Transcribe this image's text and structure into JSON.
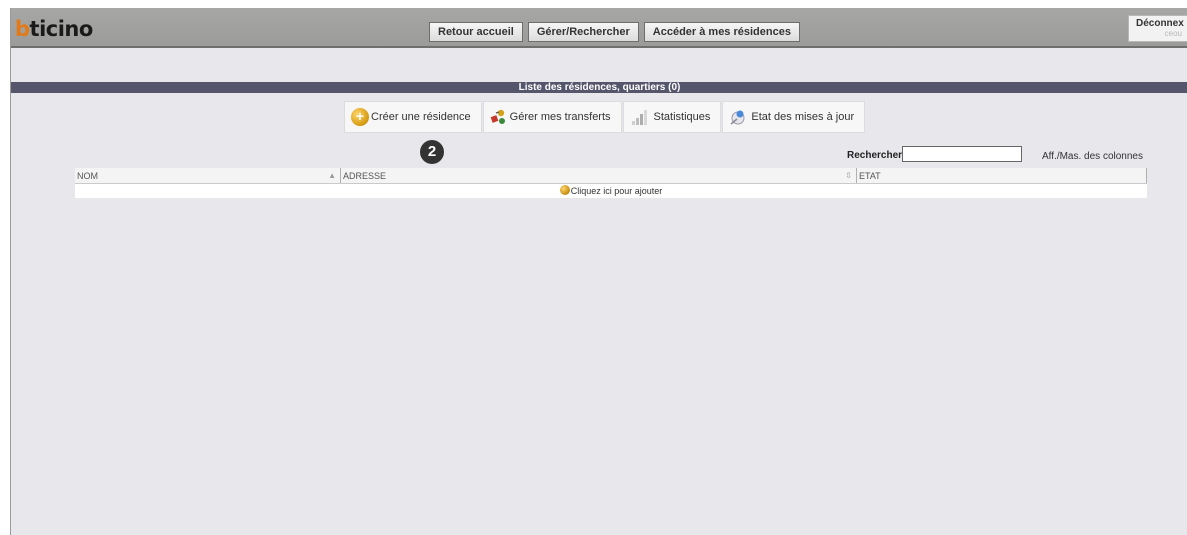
{
  "header": {
    "logo_b": "b",
    "logo_rest": "ticino",
    "nav": [
      "Retour accueil",
      "Gérer/Rechercher",
      "Accéder à mes résidences"
    ],
    "logout": "Déconnex",
    "logout_sub": "ceou"
  },
  "list": {
    "title": "Liste des résidences, quartiers (0)"
  },
  "tabs": [
    {
      "label": "Créer une résidence",
      "icon": "add-circle-icon"
    },
    {
      "label": "Gérer mes transferts",
      "icon": "transfer-icon"
    },
    {
      "label": "Statistiques",
      "icon": "bar-chart-icon"
    },
    {
      "label": "Etat des mises à jour",
      "icon": "update-icon"
    }
  ],
  "callout": "2",
  "search": {
    "label": "Rechercher",
    "value": "",
    "columns_toggle": "Aff./Mas. des colonnes"
  },
  "table": {
    "columns": [
      "NOM",
      "ADRESSE",
      "ETAT"
    ],
    "add_row": "Cliquez ici pour ajouter"
  },
  "colors": {
    "header_bg": "#9b9b99",
    "title_bar": "#55566c",
    "page_bg": "#e8e7ec",
    "logo_accent": "#e37a17"
  }
}
